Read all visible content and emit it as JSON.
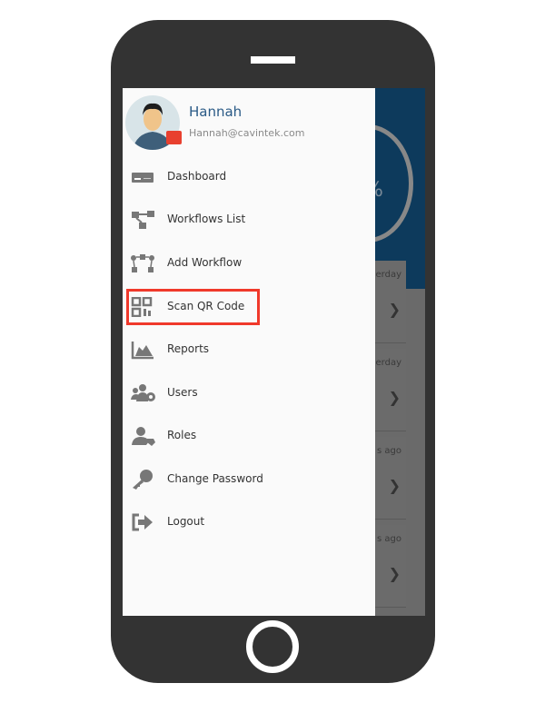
{
  "user": {
    "name": "Hannah",
    "email": "Hannah@cavintek.com"
  },
  "menu": [
    {
      "label": "Dashboard",
      "icon": "dashboard-icon"
    },
    {
      "label": "Workflows List",
      "icon": "workflow-list-icon"
    },
    {
      "label": "Add Workflow",
      "icon": "add-workflow-icon"
    },
    {
      "label": "Scan QR Code",
      "icon": "qr-code-icon",
      "highlighted": true
    },
    {
      "label": "Reports",
      "icon": "chart-icon"
    },
    {
      "label": "Users",
      "icon": "users-gear-icon"
    },
    {
      "label": "Roles",
      "icon": "user-tag-icon"
    },
    {
      "label": "Change Password",
      "icon": "key-icon"
    },
    {
      "label": "Logout",
      "icon": "logout-icon"
    }
  ],
  "background": {
    "percent_fragment": "%",
    "cards": [
      {
        "time": "erday"
      },
      {
        "time": "erday"
      },
      {
        "time": "s ago"
      },
      {
        "time": "s ago"
      }
    ]
  },
  "colors": {
    "highlight": "#f0392b",
    "header": "#0d3a5c",
    "name": "#2a5a86"
  }
}
